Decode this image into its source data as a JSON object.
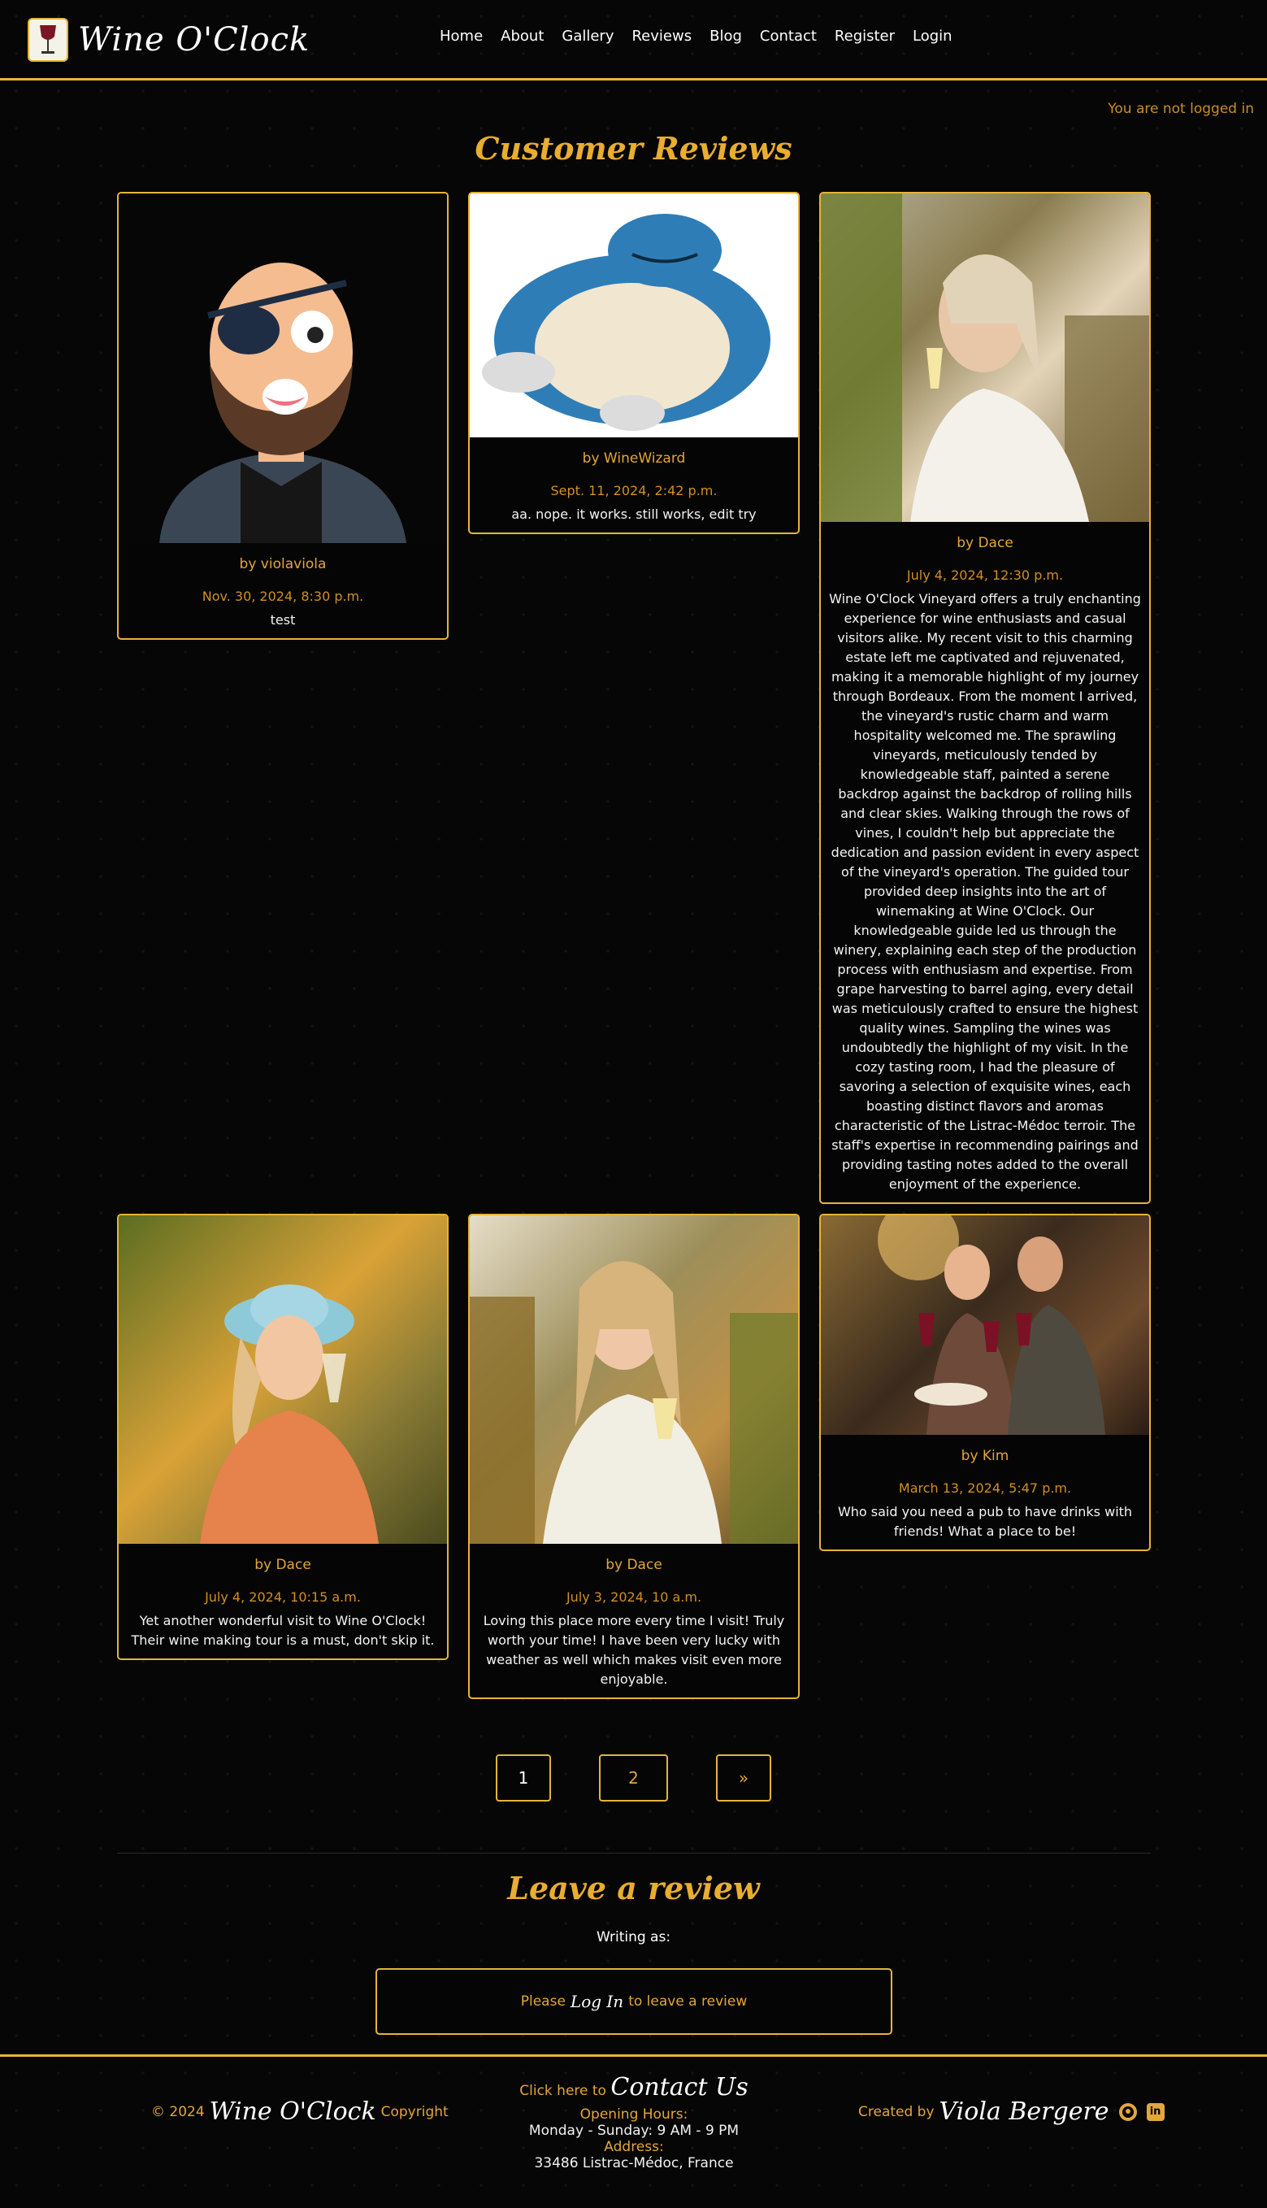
{
  "header": {
    "brand": "Wine O'Clock",
    "nav": [
      "Home",
      "About",
      "Gallery",
      "Reviews",
      "Blog",
      "Contact",
      "Register",
      "Login"
    ],
    "login_status": "You are not logged in"
  },
  "page_title": "Customer Reviews",
  "reviews": [
    {
      "author": "by violaviola",
      "date": "Nov. 30, 2024, 8:30 p.m.",
      "text": "test"
    },
    {
      "author": "by WineWizard",
      "date": "Sept. 11, 2024, 2:42 p.m.",
      "text": "aa. nope. it works. still works, edit try"
    },
    {
      "author": "by Dace",
      "date": "July 4, 2024, 12:30 p.m.",
      "text": "Wine O'Clock Vineyard offers a truly enchanting experience for wine enthusiasts and casual visitors alike. My recent visit to this charming estate left me captivated and rejuvenated, making it a memorable highlight of my journey through Bordeaux. From the moment I arrived, the vineyard's rustic charm and warm hospitality welcomed me. The sprawling vineyards, meticulously tended by knowledgeable staff, painted a serene backdrop against the backdrop of rolling hills and clear skies. Walking through the rows of vines, I couldn't help but appreciate the dedication and passion evident in every aspect of the vineyard's operation. The guided tour provided deep insights into the art of winemaking at Wine O'Clock. Our knowledgeable guide led us through the winery, explaining each step of the production process with enthusiasm and expertise. From grape harvesting to barrel aging, every detail was meticulously crafted to ensure the highest quality wines. Sampling the wines was undoubtedly the highlight of my visit. In the cozy tasting room, I had the pleasure of savoring a selection of exquisite wines, each boasting distinct flavors and aromas characteristic of the Listrac-Médoc terroir. The staff's expertise in recommending pairings and providing tasting notes added to the overall enjoyment of the experience."
    },
    {
      "author": "by Dace",
      "date": "July 4, 2024, 10:15 a.m.",
      "text": "Yet another wonderful visit to Wine O'Clock! Their wine making tour is a must, don't skip it."
    },
    {
      "author": "by Dace",
      "date": "July 3, 2024, 10 a.m.",
      "text": "Loving this place more every time I visit! Truly worth your time! I have been very lucky with weather as well which makes visit even more enjoyable."
    },
    {
      "author": "by Kim",
      "date": "March 13, 2024, 5:47 p.m.",
      "text": "Who said you need a pub to have drinks with friends! What a place to be!"
    }
  ],
  "pagination": {
    "page1": "1",
    "page2": "2",
    "next": "»"
  },
  "leave_review": {
    "title": "Leave a review",
    "writing_as": "Writing as:",
    "prompt_before": "Please",
    "login_link": "Log In",
    "prompt_after": "to leave a review"
  },
  "footer": {
    "copyright_prefix": "© 2024",
    "brand": "Wine O'Clock",
    "copyright_suffix": "Copyright",
    "contact_prefix": "Click here to",
    "contact_link": "Contact Us",
    "hours_label": "Opening Hours:",
    "hours": "Monday - Sunday: 9 AM - 9 PM",
    "address_label": "Address:",
    "address": "33486 Listrac-Médoc, France",
    "created_prefix": "Created by",
    "creator": "Viola Bergere"
  },
  "icons": [
    "wine-glass-logo-icon",
    "github-icon",
    "linkedin-icon"
  ],
  "colors": {
    "accent": "#e5b437",
    "gold_text": "#e3a63a",
    "background": "#060606"
  }
}
